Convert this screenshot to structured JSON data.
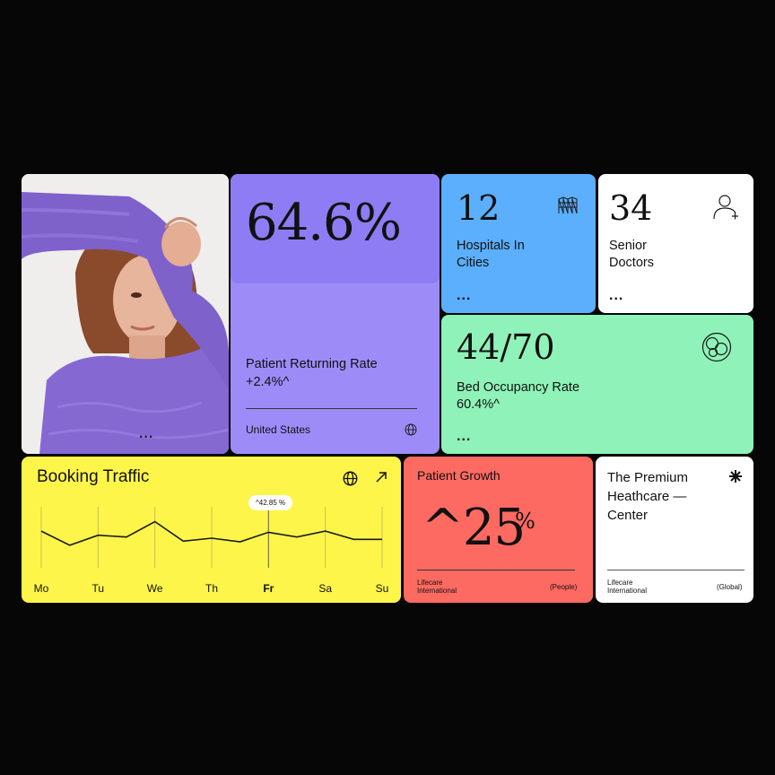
{
  "photo_card": {
    "menu": "..."
  },
  "returning": {
    "value": "64.6%",
    "label": "Patient Returning Rate",
    "change": "+2.4%^",
    "country": "United States",
    "colors": {
      "bg": "#9d8cf8",
      "panel": "#8d7cf3"
    }
  },
  "hospitals": {
    "value": "12",
    "label_1": "Hospitals In",
    "label_2": "Cities",
    "menu": "...",
    "icon": "building-grid-icon"
  },
  "doctors": {
    "value": "34",
    "label_1": "Senior",
    "label_2": "Doctors",
    "menu": "...",
    "icon": "doctor-add-icon"
  },
  "bed": {
    "value": "44/70",
    "label": "Bed Occupancy Rate",
    "change": "60.4%^",
    "menu": "...",
    "icon": "circles-icon"
  },
  "traffic": {
    "title": "Booking Traffic",
    "tooltip": "^42.85 %",
    "icons": [
      "globe-icon",
      "arrow-up-right-icon"
    ]
  },
  "chart_data": {
    "type": "line",
    "categories": [
      "Mo",
      "Tu",
      "We",
      "Th",
      "Fr",
      "Sa",
      "Su"
    ],
    "highlight": "Fr",
    "values": [
      0.62,
      0.38,
      0.55,
      0.52,
      0.78,
      0.45,
      0.5,
      0.44,
      0.6,
      0.52,
      0.62,
      0.48,
      0.48
    ],
    "annotation": "^42.85 %"
  },
  "growth": {
    "title": "Patient Growth",
    "value": "^25",
    "unit": "%",
    "org_1": "Lifecare",
    "org_2": "International",
    "scope": "(People)"
  },
  "premium": {
    "title_1": "The Premium",
    "title_2": "Heathcare —",
    "title_3": "Center",
    "org_1": "Lifecare",
    "org_2": "International",
    "scope": "(Global)",
    "icon": "asterisk-icon"
  }
}
